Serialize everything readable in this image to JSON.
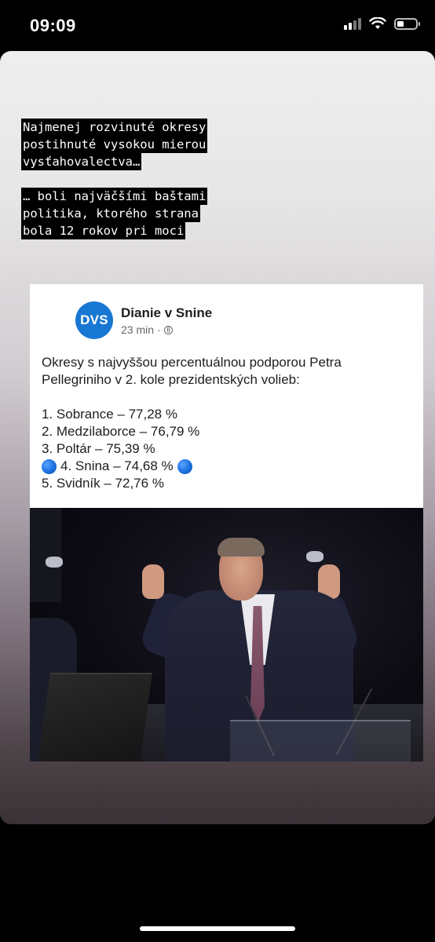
{
  "status_bar": {
    "time": "09:09",
    "icons": [
      "cellular-signal-icon",
      "wifi-icon",
      "battery-icon"
    ]
  },
  "story": {
    "caption_lines_block1": [
      "Najmenej rozvinuté okresy",
      "postihnuté vysokou mierou",
      "vysťahovalectva…"
    ],
    "caption_lines_block2": [
      "… boli najväčšími baštami",
      "politika, ktorého strana",
      "bola 12 rokov pri moci"
    ]
  },
  "post": {
    "avatar_text": "DVS",
    "page_name": "Dianie v Snine",
    "time_ago": "23 min",
    "separator": "·",
    "audience_icon": "globe-icon",
    "intro": "Okresy s najvyššou percentuálnou podporou Petra Pellegriniho v 2. kole prezidentských volieb:",
    "list": [
      "1. Sobrance – 77,28 %",
      "2. Medzilaborce – 76,79 %",
      "3. Poltár – 75,39 %",
      "4. Snina – 74,68 %",
      "5. Svidník – 72,76 %"
    ],
    "photo_icon": "photo-politician-thumbs-up"
  },
  "colors": {
    "avatar_blue": "#1877d2",
    "caption_bg": "#000000",
    "caption_text": "#ffffff",
    "emoji_dot": "#1b6fe0"
  }
}
